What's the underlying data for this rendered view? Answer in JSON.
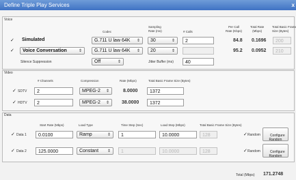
{
  "window": {
    "title": "Define Triple Play Services",
    "close_glyph": "x"
  },
  "voice": {
    "section_label": "Voice",
    "headers": {
      "codec": "Codec",
      "sampling": "Sampling\nRate (ms)",
      "calls": "# Calls",
      "per_call": "Per Call\nRate (Kbps)",
      "total_rate": "Total Rate\n(Mbps)",
      "total_basic": "Total Basic Frame\nSize (Bytes)"
    },
    "rows": [
      {
        "check": "✓",
        "name": "Simulated",
        "codec": "G.711 U law 64K",
        "sampling": "30",
        "calls": "2",
        "per_call": "84.8",
        "total_rate": "0.1696",
        "frame": "200",
        "arrow": "⇕"
      },
      {
        "check": "✓",
        "name": "Voice Conversation",
        "codec": "G.711 U law 64K",
        "sampling": "20",
        "calls": "",
        "per_call": "95.2",
        "total_rate": "0.0952",
        "frame": "210",
        "arrow": "⇕"
      }
    ],
    "silence_label": "Silence Suppression",
    "silence_value": "Off",
    "jitter_label": "Jitter Buffer (ms)",
    "jitter_value": "40"
  },
  "video": {
    "section_label": "Video",
    "headers": {
      "channels": "# Channels",
      "compression": "Compression",
      "rate": "Rate (Mbps)",
      "frame": "Total Basic Frame Size (Bytes)"
    },
    "rows": [
      {
        "check": "✓",
        "name": "SDTV",
        "channels": "2",
        "compression": "MPEG-2",
        "rate": "8.0000",
        "frame": "1372",
        "arrow": "⇕"
      },
      {
        "check": "✓",
        "name": "HDTV",
        "channels": "2",
        "compression": "MPEG-2",
        "rate": "38.0000",
        "frame": "1372",
        "arrow": "⇕"
      }
    ]
  },
  "data": {
    "section_label": "Data",
    "headers": {
      "start_rate": "Start Rate (Mbps)",
      "load_type": "Load Type",
      "time_step": "Time Step (Sec)",
      "load_step": "Load Step (Mbps)",
      "frame": "Total Basic Frame Size (Bytes)"
    },
    "rows": [
      {
        "check": "✓",
        "name": "Data 1",
        "start_rate": "0.0100",
        "load_type": "Ramp",
        "time_step": "1",
        "load_step": "10.0000",
        "frame": "128",
        "random_check": "✓",
        "random_label": "Random",
        "button": "Configure\nRandom",
        "arrow": "⇕"
      },
      {
        "check": "✓",
        "name": "Data 2",
        "start_rate": "125.0000",
        "load_type": "Constant",
        "time_step": "1",
        "load_step": "10.0000",
        "frame": "128",
        "random_check": "✓",
        "random_label": "Random",
        "button": "Configure\nRandom",
        "arrow": "⇕"
      }
    ]
  },
  "footer": {
    "total_label": "Total (Mbps)",
    "total_value": "171.2748"
  }
}
